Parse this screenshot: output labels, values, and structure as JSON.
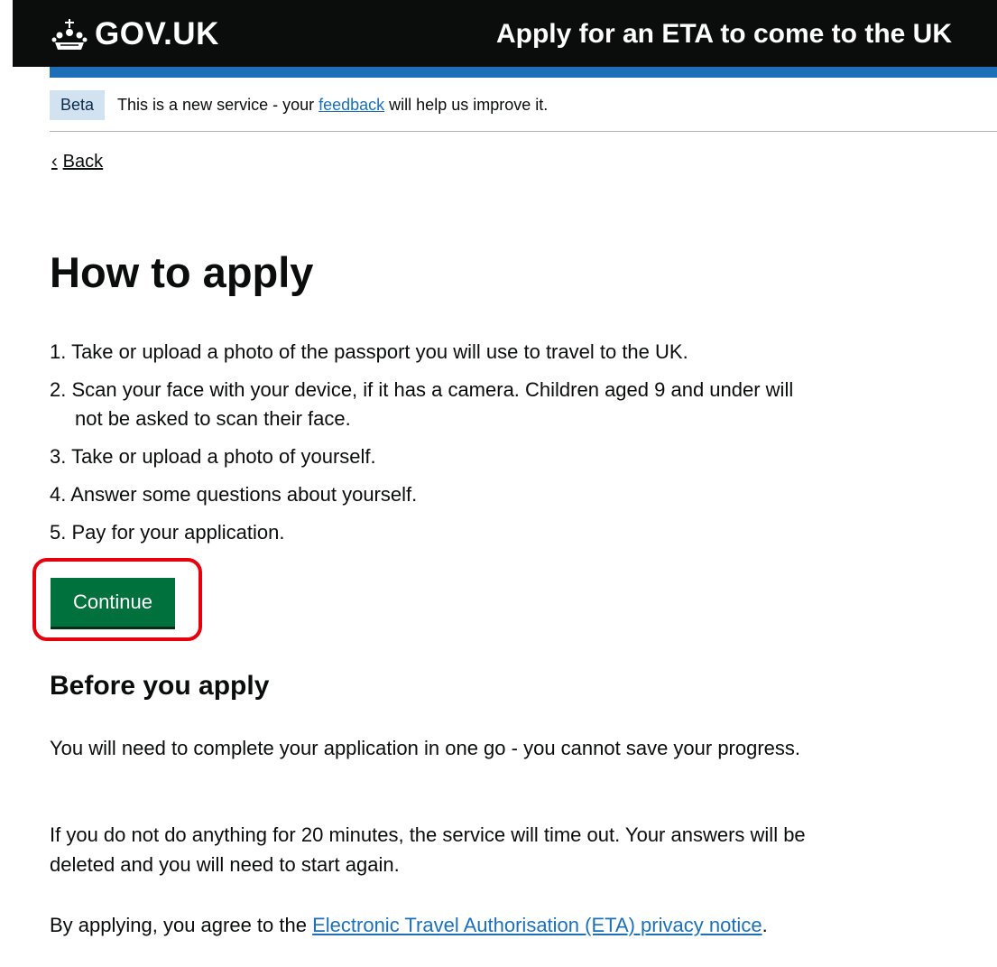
{
  "header": {
    "logo_text": "GOV.UK",
    "service_name": "Apply for an ETA to come to the UK"
  },
  "phase_banner": {
    "tag": "Beta",
    "text_before": "This is a new service - your ",
    "link": "feedback",
    "text_after": " will help us improve it."
  },
  "back_link": "Back",
  "title": "How to apply",
  "steps": [
    "1. Take or upload a photo of the passport you will use to travel to the UK.",
    "2. Scan your face with your device, if it has a camera. Children aged 9 and under will not be asked to scan their face.",
    "3. Take or upload a photo of yourself.",
    "4. Answer some questions about yourself.",
    "5. Pay for your application."
  ],
  "continue_button": "Continue",
  "before_heading": "Before you apply",
  "paragraphs": {
    "p1": "You will need to complete your application in one go - you cannot save your progress.",
    "p2": "If you do not do anything for 20 minutes, the service will time out. Your answers will be deleted and you will need to start again.",
    "p3_before": "By applying, you agree to the ",
    "p3_link": "Electronic Travel Authorisation (ETA) privacy notice",
    "p3_after": "."
  },
  "colors": {
    "header": "#0b0c0c",
    "brand_bar": "#1d70b8",
    "button": "#00703c",
    "highlight": "#e5000b",
    "link": "#1d70b8"
  },
  "icons": {
    "logo": "crown-icon",
    "back": "chevron-left-icon"
  }
}
